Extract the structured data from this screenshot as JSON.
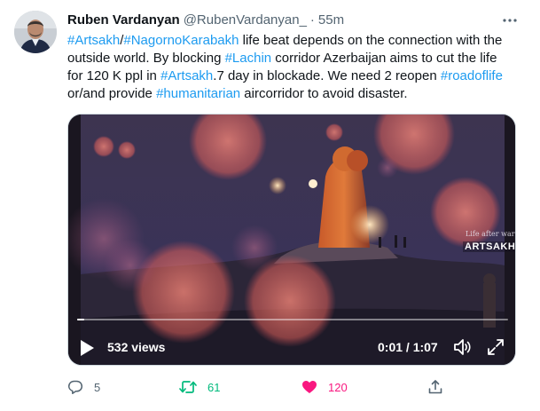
{
  "author": {
    "name": "Ruben Vardanyan",
    "handle": "@RubenVardanyan_",
    "separator": "·",
    "time": "55m"
  },
  "tweet": {
    "lines": [
      [
        {
          "text": "#Artsakh",
          "tag": true
        },
        {
          "text": "/",
          "tag": false
        },
        {
          "text": "#NagornoKarabakh",
          "tag": true
        },
        {
          "text": " life beat depends on the connection with the",
          "tag": false
        }
      ],
      [
        {
          "text": "outside world. By blocking ",
          "tag": false
        },
        {
          "text": "#Lachin",
          "tag": true
        },
        {
          "text": " corridor Azerbaijan aims to cut the life",
          "tag": false
        }
      ],
      [
        {
          "text": "for 120 K ppl in ",
          "tag": false
        },
        {
          "text": "#Artsakh",
          "tag": true
        },
        {
          "text": ".7 day in blockade. We need 2 reopen ",
          "tag": false
        },
        {
          "text": "#roadoflife",
          "tag": true
        }
      ],
      [
        {
          "text": "or/and provide ",
          "tag": false
        },
        {
          "text": "#humanitarian",
          "tag": true
        },
        {
          "text": " aircorridor to avoid disaster.",
          "tag": false
        }
      ]
    ]
  },
  "video": {
    "views": "532 views",
    "timecode": "0:01 / 1:07",
    "progress": 0.016,
    "watermark_small": "Life after war:",
    "watermark_big": "ARTSAKH"
  },
  "actions": {
    "replies": "5",
    "retweets": "61",
    "likes": "120"
  },
  "colors": {
    "link": "#1d9bf0",
    "retweet": "#00ba7c",
    "like": "#f91880",
    "muted": "#536471"
  },
  "icons": [
    "more-icon",
    "play-icon",
    "volume-icon",
    "fullscreen-icon",
    "reply-icon",
    "retweet-icon",
    "like-icon",
    "share-icon"
  ]
}
